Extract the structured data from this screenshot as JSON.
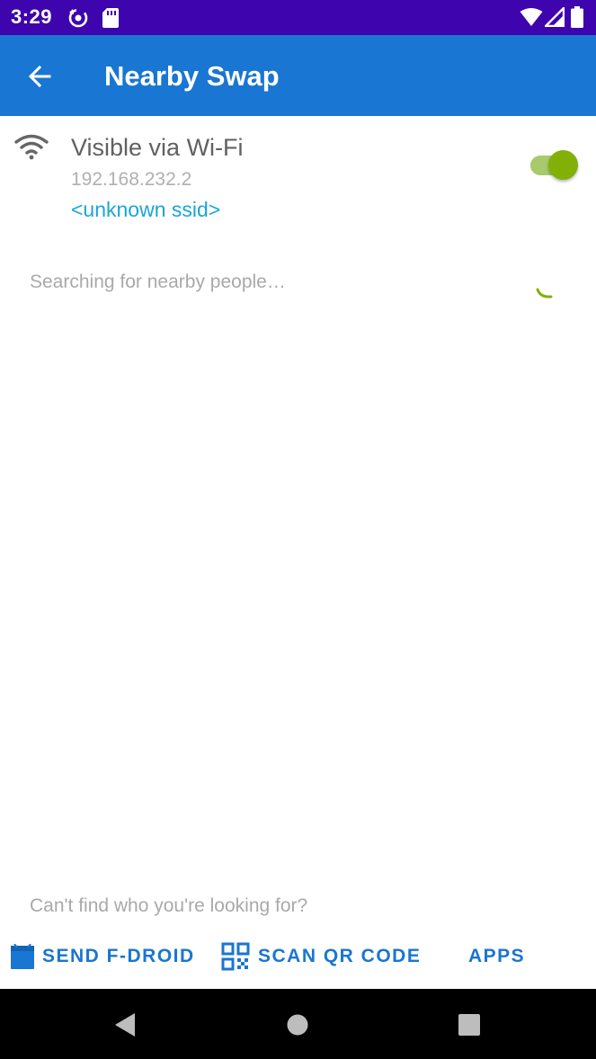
{
  "status_bar": {
    "time": "3:29",
    "icons": [
      "sync-icon",
      "sd-card-icon",
      "wifi-signal-icon",
      "cell-signal-icon",
      "battery-icon"
    ]
  },
  "app_bar": {
    "title": "Nearby Swap",
    "back_icon": "arrow-back-icon"
  },
  "wifi": {
    "icon": "wifi-icon",
    "title": "Visible via Wi-Fi",
    "ip": "192.168.232.2",
    "ssid": "<unknown ssid>",
    "toggle_on": true
  },
  "search": {
    "status_text": "Searching for nearby people…",
    "spinner_icon": "loading-spinner-icon"
  },
  "footer": {
    "cant_find_text": "Can't find who you're looking for?",
    "buttons": [
      {
        "label": "SEND F-DROID",
        "icon": "f-droid-icon"
      },
      {
        "label": "SCAN QR CODE",
        "icon": "qr-code-icon"
      },
      {
        "label": "APPS",
        "icon": ""
      }
    ]
  },
  "nav_bar": {
    "buttons": [
      "back-triangle-icon",
      "home-circle-icon",
      "recents-square-icon"
    ]
  },
  "colors": {
    "status_bar": "#3e04ad",
    "app_bar": "#1976d2",
    "accent_green": "#83b007",
    "link_blue": "#1ba5d6"
  }
}
